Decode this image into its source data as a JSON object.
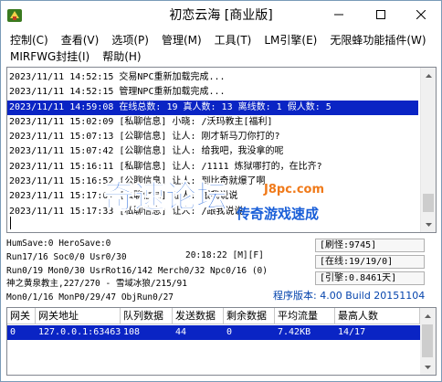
{
  "window": {
    "title": "初恋云海 [商业版]"
  },
  "menu": {
    "row1": [
      "控制(C)",
      "查看(V)",
      "选项(P)",
      "管理(M)",
      "工具(T)",
      "LM引擎(E)",
      "无限蜂功能插件(W)"
    ],
    "row2": [
      "MIRFWG封挂(I)",
      "帮助(H)"
    ]
  },
  "log": {
    "lines": [
      "2023/11/11 14:52:15 交易NPC重新加载完成...",
      "2023/11/11 14:52:15 管理NPC重新加载完成...",
      "2023/11/11 14:59:08 在线总数: 19 真人数: 13 离线数: 1 假人数: 5",
      "2023/11/11 15:02:09 [私聊信息] 小晓: /沃玛教主[福利]",
      "2023/11/11 15:07:13 [公聊信息] 让人: 刚才斩马刀你打的?",
      "2023/11/11 15:07:42 [公聊信息] 让人: 给我吧，我没拿的呢",
      "2023/11/11 15:16:11 [私聊信息] 让人: /1111 炼狱哪打的，在比齐?",
      "2023/11/11 15:16:52 [公聊信息] 让人: 到比奇就爆了啊",
      "2023/11/11 15:17:01 [公聊信息] 让人: 跟我说说",
      "2023/11/11 15:17:33 [私聊信息] 让人: /跟我说说"
    ],
    "selected_index": 2
  },
  "watermark": {
    "main": "奇速论坛",
    "site": "J8pc.com",
    "tagline": "传奇游戏速成"
  },
  "stats": {
    "line1": "HumSave:0 HeroSave:0",
    "line2_left": "Run17/16 Soc0/0 Usr0/30",
    "line2_right": "20:18:22 [M][F]",
    "line3": "Run0/19 Mon0/30 UsrRot16/142 Merch0/32 Npc0/16 (0)",
    "line4": "神之黄泉教主,227/270 - 雪域冰狼/215/91",
    "line5": "Mon0/1/16 MonP0/29/47 ObjRun0/27",
    "box1": "[刷怪:9745]",
    "box2": "[在线:19/19/0]",
    "box3": "[引擎:0.8461天]",
    "version": "程序版本: 4.00 Build 20151104"
  },
  "table": {
    "columns": [
      "网关",
      "网关地址",
      "队列数据",
      "发送数据",
      "剩余数据",
      "平均流量",
      "最高人数"
    ],
    "rows": [
      [
        "0",
        "127.0.0.1:63463",
        "108",
        "44",
        "0",
        "7.42KB",
        "14/17"
      ]
    ]
  },
  "colors": {
    "selection": "#0a24c4",
    "version_text": "#0645ad",
    "watermark_blue": "#1a5fd8",
    "watermark_orange": "#f07a1a"
  }
}
